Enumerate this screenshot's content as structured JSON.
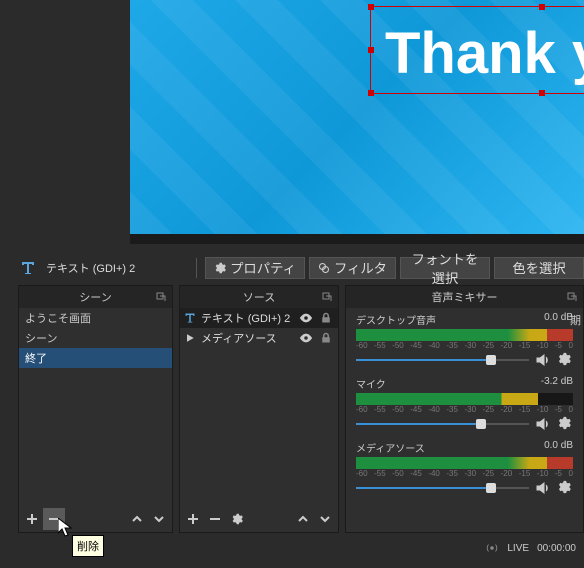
{
  "preview": {
    "text": "Thank yo"
  },
  "toolbar": {
    "source_label": "テキスト (GDI+) 2",
    "properties": "プロパティ",
    "filters": "フィルタ",
    "select_font": "フォントを選択",
    "select_color": "色を選択"
  },
  "scenes": {
    "title": "シーン",
    "items": [
      {
        "label": "ようこそ画面"
      },
      {
        "label": "シーン"
      },
      {
        "label": "終了"
      }
    ]
  },
  "sources": {
    "title": "ソース",
    "items": [
      {
        "icon": "text",
        "label": "テキスト (GDI+) 2"
      },
      {
        "icon": "play",
        "label": "メディアソース"
      }
    ]
  },
  "mixer": {
    "title": "音声ミキサー",
    "ticks": [
      "-60",
      "-55",
      "-50",
      "-45",
      "-40",
      "-35",
      "-30",
      "-25",
      "-20",
      "-15",
      "-10",
      "-5",
      "0"
    ],
    "channels": [
      {
        "name": "デスクトップ音声",
        "db": "0.0 dB",
        "level": 100,
        "slider": 78
      },
      {
        "name": "マイク",
        "db": "-3.2 dB",
        "level": 84,
        "slider": 72
      },
      {
        "name": "メディアソース",
        "db": "0.0 dB",
        "level": 100,
        "slider": 78
      }
    ]
  },
  "status": {
    "live": "LIVE",
    "time": "00:00:00"
  },
  "tooltip": {
    "text": "削除"
  },
  "extra": {
    "period": "期"
  }
}
